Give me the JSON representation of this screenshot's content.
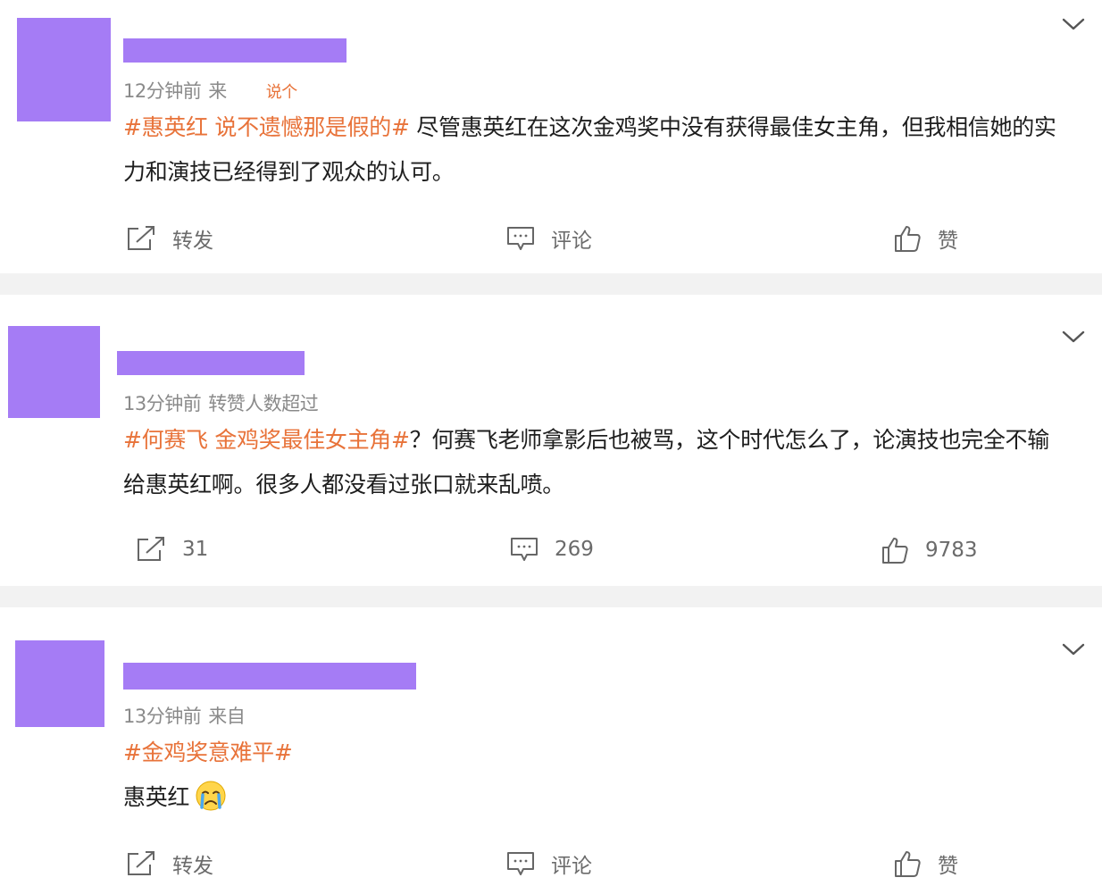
{
  "colors": {
    "topic_orange": "#e8733a",
    "mask_purple": "#a57cf5",
    "text_dark": "#1e1e1e",
    "text_gray": "#8a8a8a",
    "divider_gray": "#f2f2f2"
  },
  "posts": [
    {
      "time": "12分钟前",
      "source_a": "来",
      "source_b": "说个",
      "topic": "#惠英红 说不遗憾那是假的#",
      "body": " 尽管惠英红在这次金鸡奖中没有获得最佳女主角，但我相信她的实力和演技已经得到了观众的认可。",
      "repost_label": "转发",
      "comment_label": "评论",
      "like_label": "赞"
    },
    {
      "time": "13分钟前",
      "source": "转赞人数超过",
      "topic": "#何赛飞 金鸡奖最佳女主角#",
      "body": "？何赛飞老师拿影后也被骂，这个时代怎么了，论演技也完全不输给惠英红啊。很多人都没看过张口就来乱喷。",
      "repost_label": "31",
      "comment_label": "269",
      "like_label": "9783"
    },
    {
      "time": "13分钟前",
      "source": "来自",
      "topic": "#金鸡奖意难平#",
      "body": "惠英红",
      "emoji": "crying-face-emoji",
      "repost_label": "转发",
      "comment_label": "评论",
      "like_label": "赞"
    }
  ],
  "icons": {
    "more": "chevron-down-icon",
    "repost": "repost-icon",
    "comment": "comment-icon",
    "like": "thumbs-up-icon"
  }
}
